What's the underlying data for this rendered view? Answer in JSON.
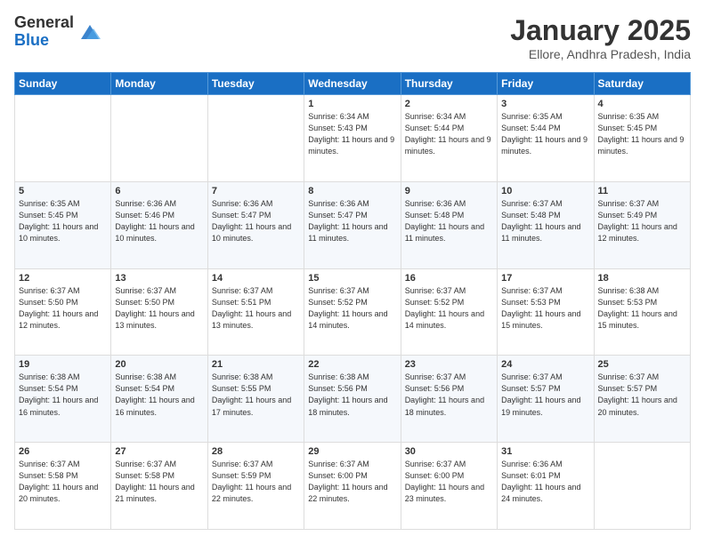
{
  "header": {
    "logo_general": "General",
    "logo_blue": "Blue",
    "month_title": "January 2025",
    "location": "Ellore, Andhra Pradesh, India"
  },
  "days_of_week": [
    "Sunday",
    "Monday",
    "Tuesday",
    "Wednesday",
    "Thursday",
    "Friday",
    "Saturday"
  ],
  "weeks": [
    [
      {
        "day": "",
        "sunrise": "",
        "sunset": "",
        "daylight": ""
      },
      {
        "day": "",
        "sunrise": "",
        "sunset": "",
        "daylight": ""
      },
      {
        "day": "",
        "sunrise": "",
        "sunset": "",
        "daylight": ""
      },
      {
        "day": "1",
        "sunrise": "Sunrise: 6:34 AM",
        "sunset": "Sunset: 5:43 PM",
        "daylight": "Daylight: 11 hours and 9 minutes."
      },
      {
        "day": "2",
        "sunrise": "Sunrise: 6:34 AM",
        "sunset": "Sunset: 5:44 PM",
        "daylight": "Daylight: 11 hours and 9 minutes."
      },
      {
        "day": "3",
        "sunrise": "Sunrise: 6:35 AM",
        "sunset": "Sunset: 5:44 PM",
        "daylight": "Daylight: 11 hours and 9 minutes."
      },
      {
        "day": "4",
        "sunrise": "Sunrise: 6:35 AM",
        "sunset": "Sunset: 5:45 PM",
        "daylight": "Daylight: 11 hours and 9 minutes."
      }
    ],
    [
      {
        "day": "5",
        "sunrise": "Sunrise: 6:35 AM",
        "sunset": "Sunset: 5:45 PM",
        "daylight": "Daylight: 11 hours and 10 minutes."
      },
      {
        "day": "6",
        "sunrise": "Sunrise: 6:36 AM",
        "sunset": "Sunset: 5:46 PM",
        "daylight": "Daylight: 11 hours and 10 minutes."
      },
      {
        "day": "7",
        "sunrise": "Sunrise: 6:36 AM",
        "sunset": "Sunset: 5:47 PM",
        "daylight": "Daylight: 11 hours and 10 minutes."
      },
      {
        "day": "8",
        "sunrise": "Sunrise: 6:36 AM",
        "sunset": "Sunset: 5:47 PM",
        "daylight": "Daylight: 11 hours and 11 minutes."
      },
      {
        "day": "9",
        "sunrise": "Sunrise: 6:36 AM",
        "sunset": "Sunset: 5:48 PM",
        "daylight": "Daylight: 11 hours and 11 minutes."
      },
      {
        "day": "10",
        "sunrise": "Sunrise: 6:37 AM",
        "sunset": "Sunset: 5:48 PM",
        "daylight": "Daylight: 11 hours and 11 minutes."
      },
      {
        "day": "11",
        "sunrise": "Sunrise: 6:37 AM",
        "sunset": "Sunset: 5:49 PM",
        "daylight": "Daylight: 11 hours and 12 minutes."
      }
    ],
    [
      {
        "day": "12",
        "sunrise": "Sunrise: 6:37 AM",
        "sunset": "Sunset: 5:50 PM",
        "daylight": "Daylight: 11 hours and 12 minutes."
      },
      {
        "day": "13",
        "sunrise": "Sunrise: 6:37 AM",
        "sunset": "Sunset: 5:50 PM",
        "daylight": "Daylight: 11 hours and 13 minutes."
      },
      {
        "day": "14",
        "sunrise": "Sunrise: 6:37 AM",
        "sunset": "Sunset: 5:51 PM",
        "daylight": "Daylight: 11 hours and 13 minutes."
      },
      {
        "day": "15",
        "sunrise": "Sunrise: 6:37 AM",
        "sunset": "Sunset: 5:52 PM",
        "daylight": "Daylight: 11 hours and 14 minutes."
      },
      {
        "day": "16",
        "sunrise": "Sunrise: 6:37 AM",
        "sunset": "Sunset: 5:52 PM",
        "daylight": "Daylight: 11 hours and 14 minutes."
      },
      {
        "day": "17",
        "sunrise": "Sunrise: 6:37 AM",
        "sunset": "Sunset: 5:53 PM",
        "daylight": "Daylight: 11 hours and 15 minutes."
      },
      {
        "day": "18",
        "sunrise": "Sunrise: 6:38 AM",
        "sunset": "Sunset: 5:53 PM",
        "daylight": "Daylight: 11 hours and 15 minutes."
      }
    ],
    [
      {
        "day": "19",
        "sunrise": "Sunrise: 6:38 AM",
        "sunset": "Sunset: 5:54 PM",
        "daylight": "Daylight: 11 hours and 16 minutes."
      },
      {
        "day": "20",
        "sunrise": "Sunrise: 6:38 AM",
        "sunset": "Sunset: 5:54 PM",
        "daylight": "Daylight: 11 hours and 16 minutes."
      },
      {
        "day": "21",
        "sunrise": "Sunrise: 6:38 AM",
        "sunset": "Sunset: 5:55 PM",
        "daylight": "Daylight: 11 hours and 17 minutes."
      },
      {
        "day": "22",
        "sunrise": "Sunrise: 6:38 AM",
        "sunset": "Sunset: 5:56 PM",
        "daylight": "Daylight: 11 hours and 18 minutes."
      },
      {
        "day": "23",
        "sunrise": "Sunrise: 6:37 AM",
        "sunset": "Sunset: 5:56 PM",
        "daylight": "Daylight: 11 hours and 18 minutes."
      },
      {
        "day": "24",
        "sunrise": "Sunrise: 6:37 AM",
        "sunset": "Sunset: 5:57 PM",
        "daylight": "Daylight: 11 hours and 19 minutes."
      },
      {
        "day": "25",
        "sunrise": "Sunrise: 6:37 AM",
        "sunset": "Sunset: 5:57 PM",
        "daylight": "Daylight: 11 hours and 20 minutes."
      }
    ],
    [
      {
        "day": "26",
        "sunrise": "Sunrise: 6:37 AM",
        "sunset": "Sunset: 5:58 PM",
        "daylight": "Daylight: 11 hours and 20 minutes."
      },
      {
        "day": "27",
        "sunrise": "Sunrise: 6:37 AM",
        "sunset": "Sunset: 5:58 PM",
        "daylight": "Daylight: 11 hours and 21 minutes."
      },
      {
        "day": "28",
        "sunrise": "Sunrise: 6:37 AM",
        "sunset": "Sunset: 5:59 PM",
        "daylight": "Daylight: 11 hours and 22 minutes."
      },
      {
        "day": "29",
        "sunrise": "Sunrise: 6:37 AM",
        "sunset": "Sunset: 6:00 PM",
        "daylight": "Daylight: 11 hours and 22 minutes."
      },
      {
        "day": "30",
        "sunrise": "Sunrise: 6:37 AM",
        "sunset": "Sunset: 6:00 PM",
        "daylight": "Daylight: 11 hours and 23 minutes."
      },
      {
        "day": "31",
        "sunrise": "Sunrise: 6:36 AM",
        "sunset": "Sunset: 6:01 PM",
        "daylight": "Daylight: 11 hours and 24 minutes."
      },
      {
        "day": "",
        "sunrise": "",
        "sunset": "",
        "daylight": ""
      }
    ]
  ]
}
